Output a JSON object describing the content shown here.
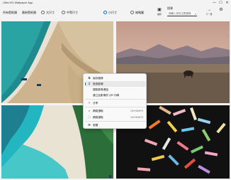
{
  "window": {
    "title": "Ultra HD Wallpaper App",
    "controls": [
      "—",
      "☐",
      "✕"
    ]
  },
  "toolbar": {
    "mode_a": "所有壁紙類",
    "mode_b": "最新壁紙類",
    "sizes": [
      {
        "label": "大尺寸",
        "selected": false
      },
      {
        "label": "中等尺寸",
        "selected": false
      },
      {
        "label": "小尺寸",
        "selected": true
      },
      {
        "label": "縮略圖",
        "selected": false
      }
    ],
    "save_icon": "save-icon",
    "save_label": "儲存",
    "search_label": "搜尋",
    "search_placeholder": "請輸入你的主題搜尋",
    "next_label": "下一頁",
    "settings_label": "設定"
  },
  "menu": {
    "items": [
      {
        "icon": "copy-icon",
        "label": "保存圖像",
        "shortcut": "",
        "highlighted": false
      },
      {
        "icon": "crop-icon",
        "label": "檢查影像",
        "shortcut": "",
        "highlighted": true
      },
      {
        "icon": "",
        "label": "複製影像連結",
        "shortcut": "",
        "highlighted": false
      },
      {
        "icon": "",
        "label": "建立此影像的 QR 代碼",
        "shortcut": "",
        "highlighted": false
      },
      {
        "icon": "share-icon",
        "label": "分享",
        "shortcut": "",
        "highlighted": false
      },
      {
        "icon": "search-icon",
        "label": "網頁選取",
        "shortcut": "Ctrl+Shift+S",
        "highlighted": false
      },
      {
        "icon": "camera-icon",
        "label": "網頁擷取",
        "shortcut": "Ctrl+Shift+S",
        "highlighted": false
      },
      {
        "icon": "inspect-icon",
        "label": "檢閱",
        "shortcut": "",
        "highlighted": false
      }
    ]
  },
  "colors": {
    "accent": "#0067c0",
    "menu_bg": "#f9f9f9",
    "app_bg": "#f3f3f3"
  }
}
